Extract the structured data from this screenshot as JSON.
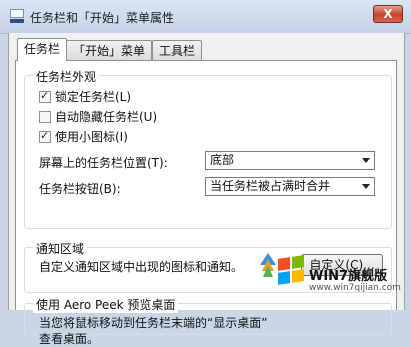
{
  "window": {
    "title": "任务栏和「开始」菜单属性",
    "close_glyph": "X"
  },
  "tabs": [
    {
      "label": "任务栏",
      "active": true
    },
    {
      "label": "「开始」菜单",
      "active": false
    },
    {
      "label": "工具栏",
      "active": false
    }
  ],
  "appearance": {
    "title": "任务栏外观",
    "lock": {
      "label": "锁定任务栏(L)",
      "checked": true
    },
    "autohide": {
      "label": "自动隐藏任务栏(U)",
      "checked": false
    },
    "small_icons": {
      "label": "使用小图标(I)",
      "checked": true
    },
    "location_label": "屏幕上的任务栏位置(T):",
    "location_value": "底部",
    "buttons_label": "任务栏按钮(B):",
    "buttons_value": "当任务栏被占满时合并"
  },
  "notification": {
    "title": "通知区域",
    "description": "自定义通知区域中出现的图标和通知。",
    "customize_button": "自定义(C)..."
  },
  "aero_peek": {
    "title": "使用 Aero Peek 预览桌面",
    "description_line1": "当您将鼠标移动到任务栏末端的“显示桌面”",
    "description_line2": "查看桌面。"
  },
  "watermark": {
    "text": "WIN7旗舰版",
    "url": "www.win7qijian.com",
    "logo_icon": "windows-flag-icon"
  },
  "colors": {
    "flag_red": "#f25022",
    "flag_green": "#7fba00",
    "flag_blue": "#00a4ef",
    "flag_yellow": "#ffb900"
  }
}
